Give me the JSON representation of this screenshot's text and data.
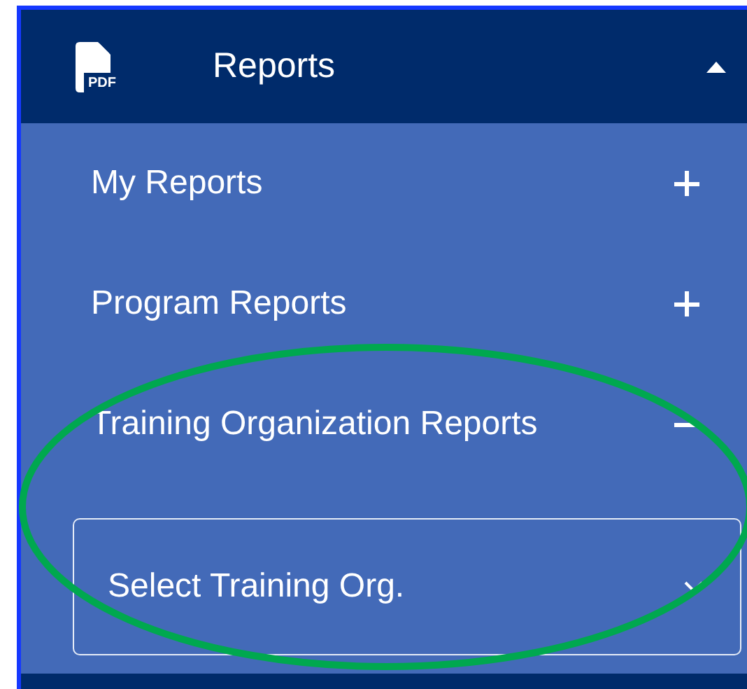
{
  "menu": {
    "icon_label": "PDF",
    "title": "Reports",
    "expanded": true,
    "items": [
      {
        "label": "My Reports",
        "expanded": false
      },
      {
        "label": "Program Reports",
        "expanded": false
      },
      {
        "label": "Training Organization Reports",
        "expanded": true,
        "field": {
          "placeholder": "Select Training Org."
        }
      }
    ]
  },
  "annotation": {
    "kind": "ellipse"
  }
}
